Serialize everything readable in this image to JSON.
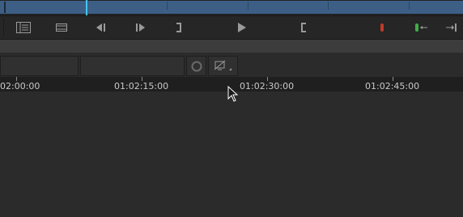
{
  "colors": {
    "mini_track": "#3d5f86",
    "playhead": "#48c4f0",
    "toolbar_bg": "#262626",
    "ruler_bg": "#1f1f1f",
    "ruler_text": "#c8c8c8",
    "in_marker": "#c0392b",
    "out_marker": "#3fae49"
  },
  "toolbar": {
    "buttons": [
      {
        "name": "timeline-view-icon"
      },
      {
        "name": "film-strip-icon"
      },
      {
        "name": "previous-edit-icon"
      },
      {
        "name": "next-edit-icon"
      },
      {
        "name": "mark-out-icon"
      },
      {
        "name": "play-icon"
      },
      {
        "name": "mark-in-icon"
      },
      {
        "name": "red-marker-icon"
      },
      {
        "name": "green-marker-icon"
      },
      {
        "name": "go-to-end-icon"
      }
    ]
  },
  "fields": {
    "field1_value": "",
    "field2_value": ""
  },
  "ruler": {
    "labels": [
      "02:00:00",
      "01:02:15:00",
      "01:02:30:00",
      "01:02:45:00"
    ]
  }
}
